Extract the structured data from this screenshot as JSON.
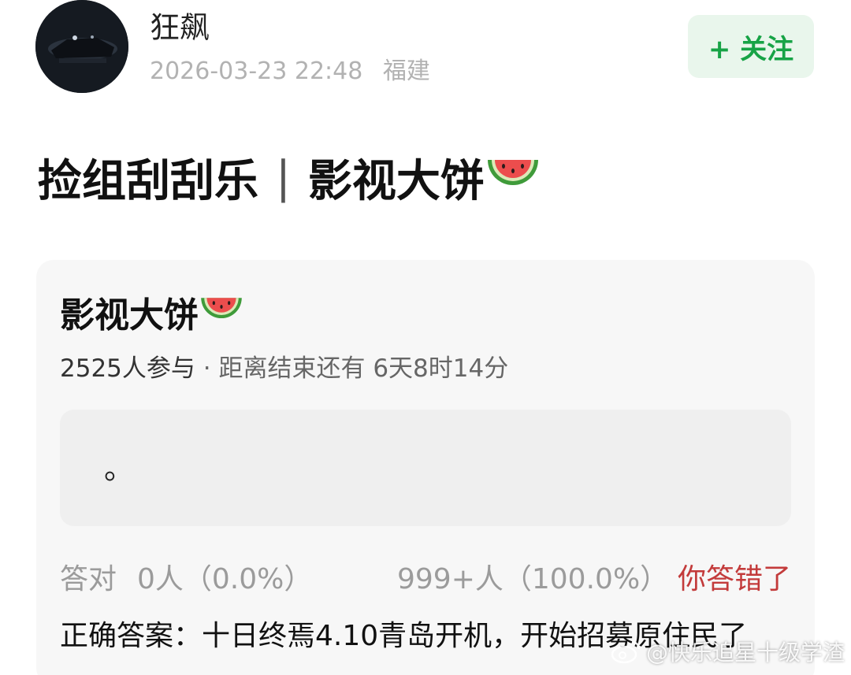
{
  "post": {
    "author": "狂飙",
    "timestamp": "2026-03-23 22:48",
    "location": "福建",
    "follow_label": "+ 关注",
    "title_part1": "捡组刮刮乐",
    "title_separator": "|",
    "title_part2": "影视大饼",
    "title_emoji_icon": "watermelon-icon"
  },
  "quiz_card": {
    "title": "影视大饼",
    "participants": "2525人参与",
    "dot_separator": "·",
    "countdown": "距离结束还有 6天8时14分",
    "answer_text": "。",
    "correct_label": "答对",
    "correct_count": "0人（0.0%）",
    "wrong_count": "999+人（100.0%）",
    "wrong_note": "你答错了",
    "solution": "正确答案：十日终焉4.10青岛开机，开始招募原住民了"
  },
  "watermark": {
    "text": "@快乐追星十级学渣"
  },
  "colors": {
    "follow_green": "#17a346",
    "follow_bg": "#e9f6ec",
    "wrong_red": "#c33b3b",
    "card_bg": "#f7f7f7"
  }
}
